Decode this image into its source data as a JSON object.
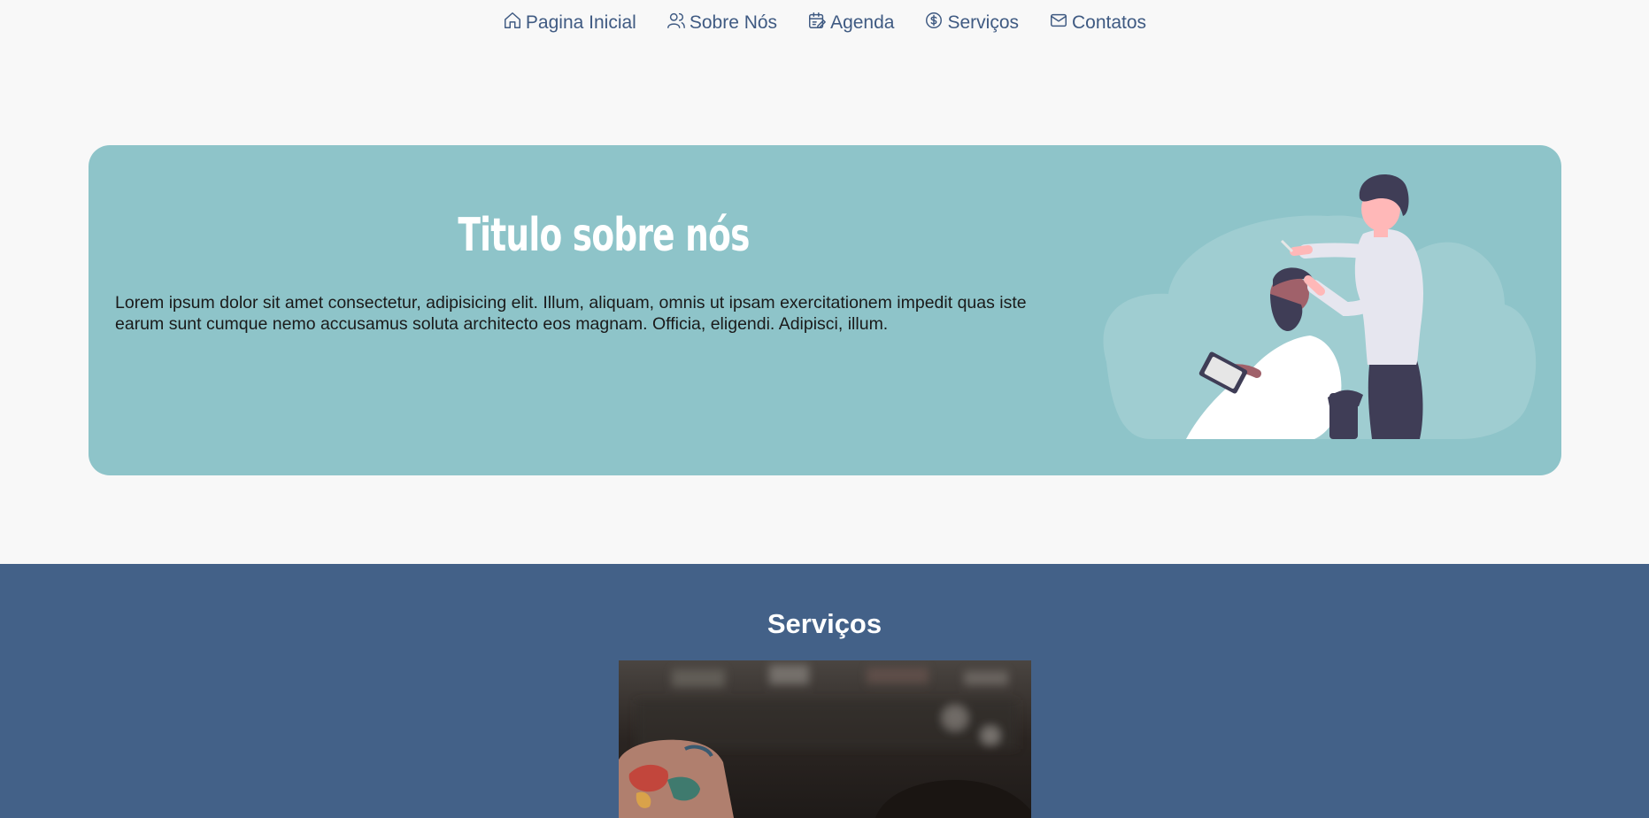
{
  "nav": {
    "items": [
      {
        "label": "Pagina Inicial",
        "icon": "home-icon"
      },
      {
        "label": "Sobre Nós",
        "icon": "users-icon"
      },
      {
        "label": "Agenda",
        "icon": "calendar-edit-icon"
      },
      {
        "label": "Serviços",
        "icon": "dollar-circle-icon"
      },
      {
        "label": "Contatos",
        "icon": "mail-icon"
      }
    ],
    "color": "#3f5a82"
  },
  "about": {
    "title": "Titulo sobre nós",
    "text": "Lorem ipsum dolor sit amet consectetur, adipisicing elit. Illum, aliquam, omnis ut ipsam exercitationem impedit quas iste earum sunt cumque nemo accusamus soluta architecto eos magnam. Officia, eligendi. Adipisci, illum.",
    "background": "#8ec4c9",
    "illustration": "barber-cutting-hair-illustration"
  },
  "services": {
    "title": "Serviços",
    "background": "#436188",
    "photo": "barber-tattooed-hands-photo"
  }
}
